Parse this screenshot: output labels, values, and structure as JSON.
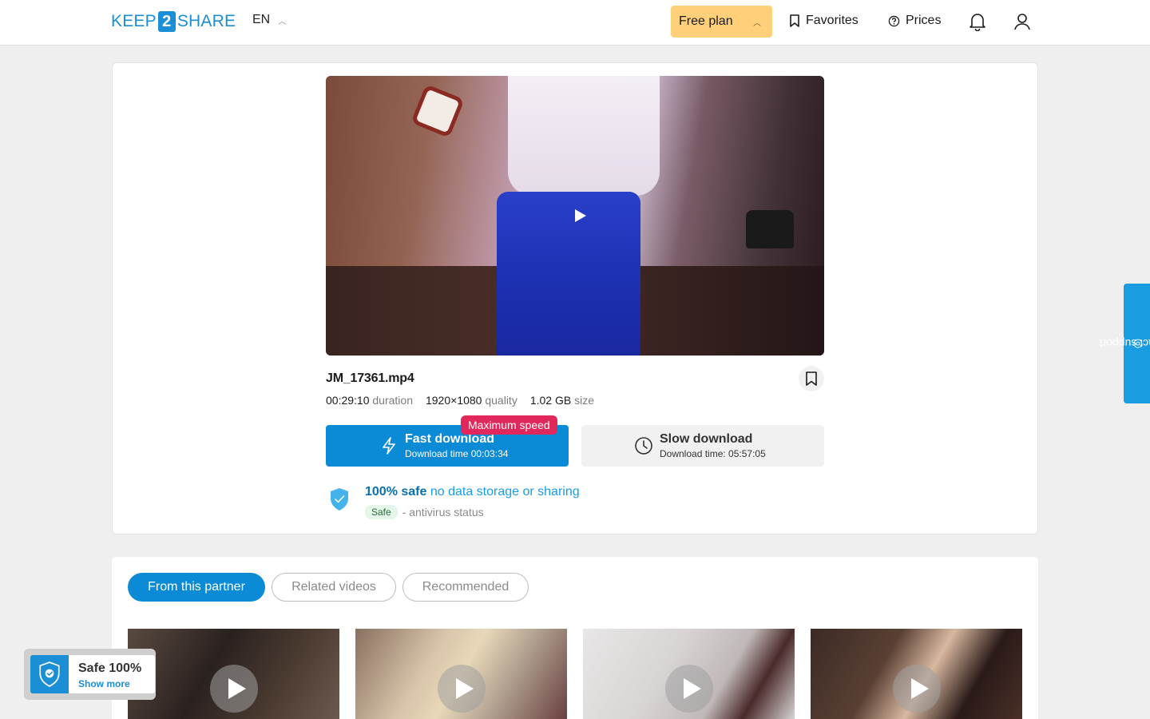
{
  "header": {
    "logo_left": "KEEP",
    "logo_mid": "2",
    "logo_right": "SHARE",
    "language": "EN",
    "free_plan": "Free plan",
    "favorites": "Favorites",
    "prices": "Prices"
  },
  "file": {
    "name": "JM_17361.mp4",
    "duration_value": "00:29:10",
    "duration_label": "duration",
    "quality_value": "1920×1080",
    "quality_label": "quality",
    "size_value": "1.02 GB",
    "size_label": "size"
  },
  "downloads": {
    "max_speed_badge": "Maximum speed",
    "fast_title": "Fast download",
    "fast_time": "Download time 00:03:34",
    "slow_title": "Slow download",
    "slow_time": "Download time: 05:57:05"
  },
  "safety": {
    "bold": "100% safe",
    "text": "no data storage or sharing",
    "tag": "Safe",
    "antivirus": "- antivirus status"
  },
  "tabs": [
    {
      "label": "From this partner"
    },
    {
      "label": "Related videos"
    },
    {
      "label": "Recommended"
    }
  ],
  "safe_badge": {
    "title": "Safe 100%",
    "link": "Show more"
  },
  "support": "contact support",
  "colors": {
    "primary": "#0b8ad6",
    "free_plan_bg": "#ffd079",
    "max_speed": "#e0285a"
  }
}
